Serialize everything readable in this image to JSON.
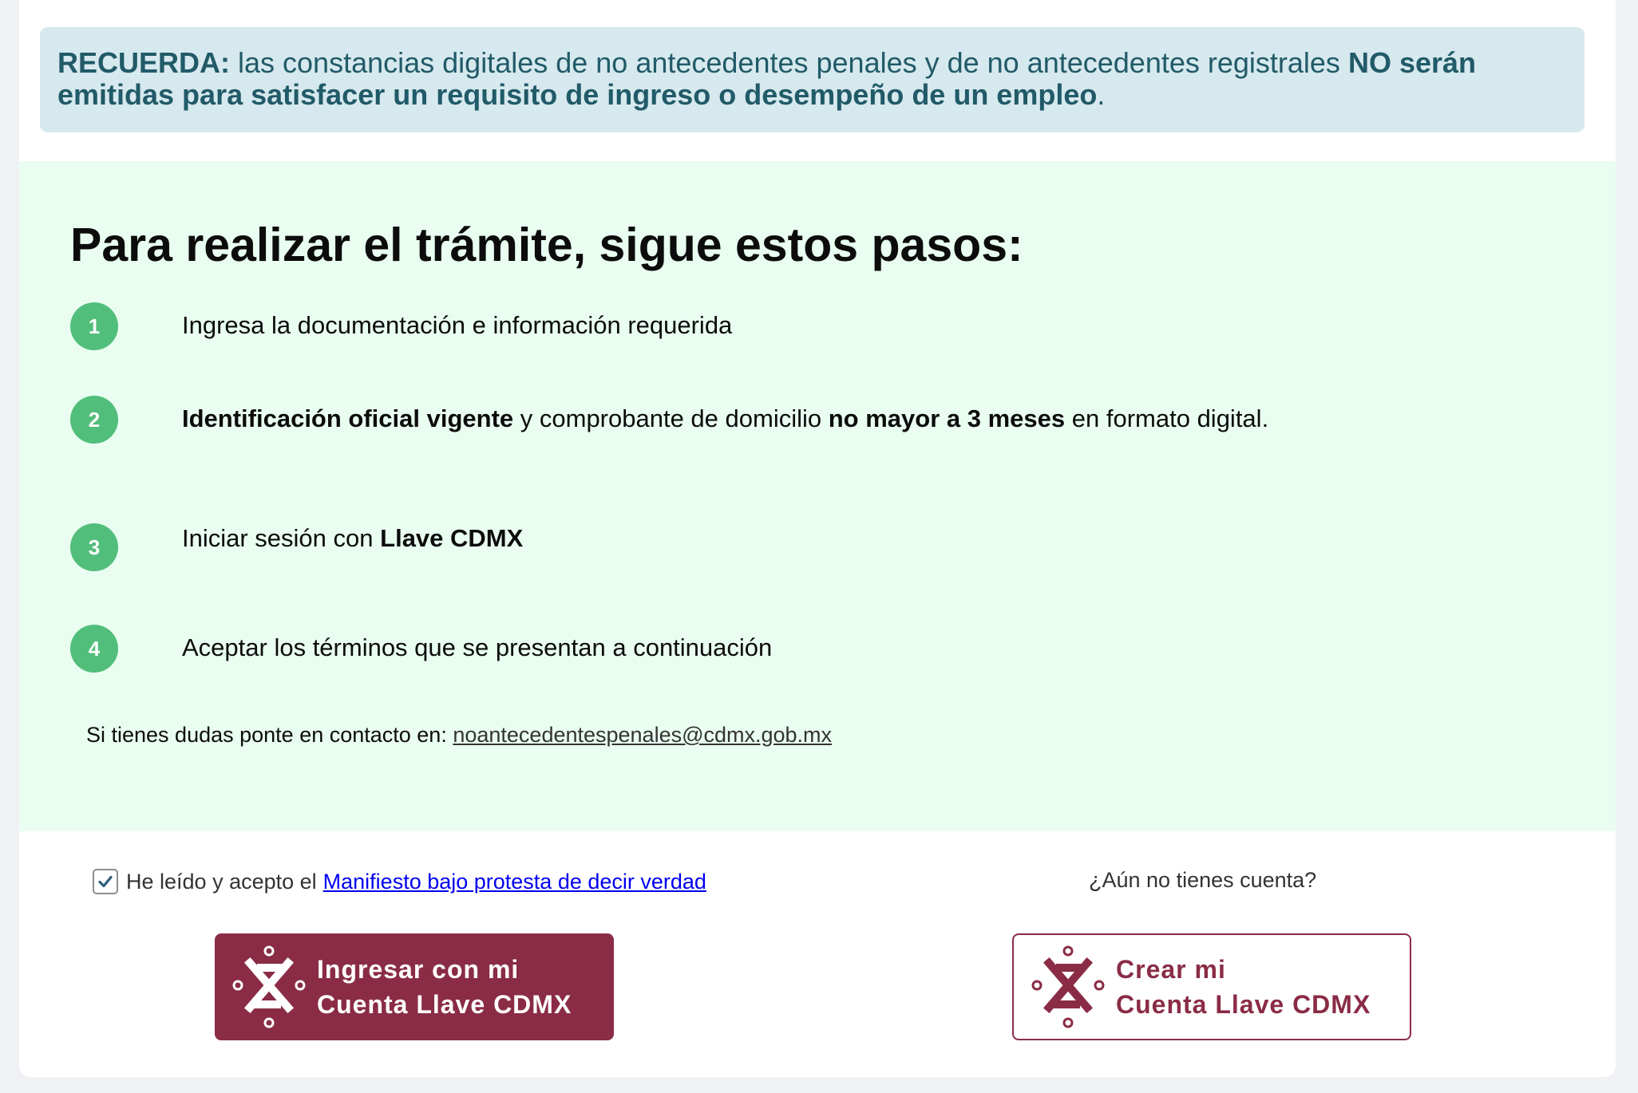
{
  "alert": {
    "label": "RECUERDA:",
    "text1": "las constancias digitales de no antecedentes penales y de no antecedentes registrales",
    "bold": "NO serán emitidas para satisfacer un requisito de ingreso o desempeño de un empleo",
    "end": "."
  },
  "steps": {
    "title": "Para realizar el trámite, sigue estos pasos:",
    "items": [
      {
        "number": "1",
        "text": "Ingresa la documentación e información requerida"
      },
      {
        "number": "2",
        "bold1": "Identificación oficial vigente",
        "text1": "y comprobante de domicilio",
        "bold2": "no mayor a 3 meses",
        "text2": "en formato digital."
      },
      {
        "number": "3",
        "text": "Iniciar sesión con",
        "bold": "Llave CDMX"
      },
      {
        "number": "4",
        "text": "Aceptar los términos que se presentan a continuación"
      }
    ],
    "contact_label": "Si tienes dudas ponte en contacto en:",
    "contact_email": "noantecedentespenales@cdmx.gob.mx"
  },
  "agreement": {
    "checked": true,
    "text": "He leído y acepto el",
    "link": "Manifiesto bajo protesta de decir verdad"
  },
  "no_account": "¿Aún no tienes cuenta?",
  "buttons": {
    "login_line1": "Ingresar con mi",
    "login_line2": "Cuenta Llave CDMX",
    "create_line1": "Crear mi",
    "create_line2": "Cuenta Llave CDMX",
    "icon": "llave-cdmx-logo",
    "brand_color": "#8a2c46"
  },
  "colors": {
    "alert_bg": "#d6e9ee",
    "alert_text": "#215a68",
    "steps_bg": "#e9fdf1",
    "badge": "#52be7b"
  }
}
